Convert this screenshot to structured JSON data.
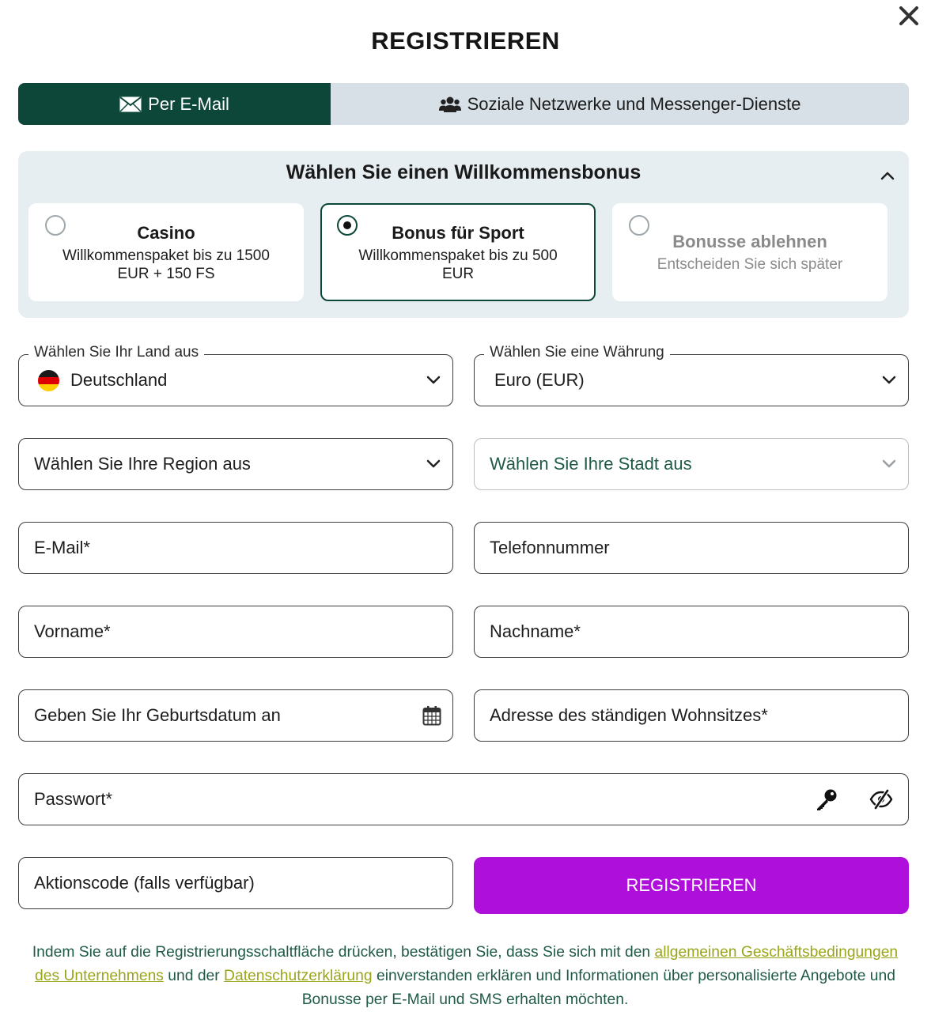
{
  "header": {
    "title": "REGISTRIEREN",
    "close_icon": "close-icon"
  },
  "tabs": [
    {
      "label": "Per E-Mail",
      "icon": "envelope-icon",
      "active": true
    },
    {
      "label": "Soziale Netzwerke und Messenger-Dienste",
      "icon": "users-icon",
      "active": false
    }
  ],
  "bonus": {
    "title": "Wählen Sie einen Willkommensbonus",
    "expanded": true,
    "options": [
      {
        "title": "Casino",
        "subtitle": "Willkommenspaket bis zu 1500 EUR + 150 FS",
        "selected": false
      },
      {
        "title": "Bonus für Sport",
        "subtitle": "Willkommenspaket bis zu 500 EUR",
        "selected": true
      },
      {
        "title": "Bonusse ablehnen",
        "subtitle": "Entscheiden Sie sich später",
        "selected": false
      }
    ]
  },
  "form": {
    "country": {
      "label": "Wählen Sie Ihr Land aus",
      "value": "Deutschland"
    },
    "currency": {
      "label": "Wählen Sie eine Währung",
      "value": "Euro (EUR)"
    },
    "region": {
      "placeholder": "Wählen Sie Ihre Region aus"
    },
    "city": {
      "placeholder": "Wählen Sie Ihre Stadt aus"
    },
    "email": {
      "placeholder": "E-Mail*"
    },
    "phone": {
      "placeholder": "Telefonnummer"
    },
    "first_name": {
      "placeholder": "Vorname*"
    },
    "last_name": {
      "placeholder": "Nachname*"
    },
    "birthdate": {
      "placeholder": "Geben Sie Ihr Geburtsdatum an"
    },
    "address": {
      "placeholder": "Adresse des ständigen Wohnsitzes*"
    },
    "password": {
      "placeholder": "Passwort*"
    },
    "promo": {
      "placeholder": "Aktionscode (falls verfügbar)"
    },
    "submit_label": "REGISTRIEREN"
  },
  "legal": {
    "part1": "Indem Sie auf die Registrierungsschaltfläche drücken, bestätigen Sie, dass Sie sich mit den ",
    "link_terms": "allgemeinen Geschäftsbedingungen des Unternehmens",
    "part2": " und der ",
    "link_privacy": "Datenschutzerklärung",
    "part3": " einverstanden erklären und Informationen über personalisierte Angebote und Bonusse per E-Mail und SMS erhalten möchten."
  },
  "colors": {
    "primary_dark_green": "#0d4739",
    "submit_purple": "#af0fdb",
    "link_olive": "#9aa51a",
    "legal_text_green": "#1f5a47",
    "tab_inactive": "#d6e0e6",
    "bonus_panel_bg": "#e7eef2"
  }
}
